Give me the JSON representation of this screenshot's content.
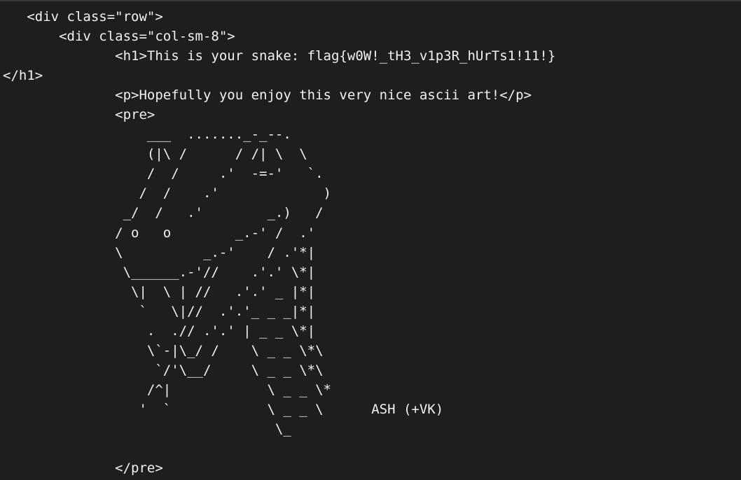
{
  "terminal": {
    "lines": [
      "   <div class=\"row\">",
      "       <div class=\"col-sm-8\">",
      "              <h1>This is your snake: flag{w0W!_tH3_v1p3R_hUrTs1!11!}",
      "</h1>",
      "              <p>Hopefully you enjoy this very nice ascii art!</p>",
      "              <pre>",
      "                  ___  ......._-_--.",
      "                  (|\\ /      / /| \\  \\",
      "                  /  /     .'  -=-'   `.",
      "                 /  /    .'             )",
      "               _/  /   .'        _.)   /",
      "              / o   o        _.-' /  .'",
      "              \\          _.-'    / .'*|",
      "               \\______.-'//    .'.' \\*|",
      "                \\|  \\ | //   .'.' _ |*|",
      "                 `   \\|//  .'.'_ _ _|*|",
      "                  .  .// .'.' | _ _ \\*|",
      "                  \\`-|\\_/ /    \\ _ _ \\*\\",
      "                   `/'\\__/     \\ _ _ \\*\\",
      "                  /^|            \\ _ _ \\*",
      "                 '  `            \\ _ _ \\      ASH (+VK)",
      "                                  \\_",
      "",
      "              </pre>"
    ]
  }
}
